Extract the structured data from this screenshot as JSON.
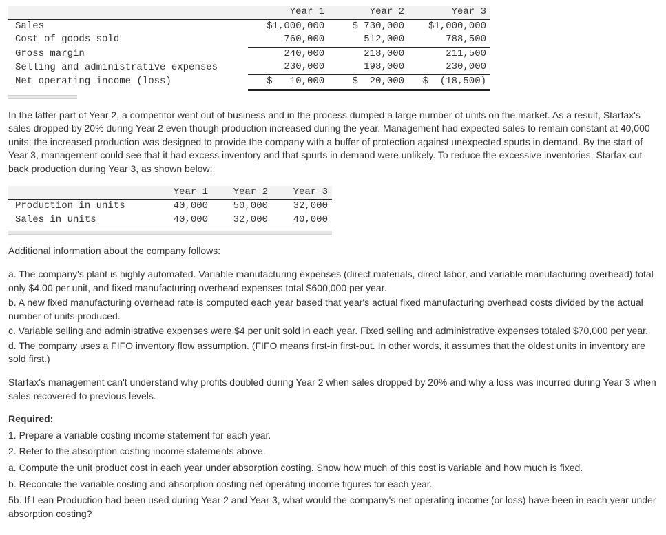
{
  "table1": {
    "headers": [
      "Year 1",
      "Year 2",
      "Year 3"
    ],
    "rows": [
      {
        "label": "Sales",
        "y1": "$1,000,000",
        "y2": "$ 730,000",
        "y3": "$1,000,000"
      },
      {
        "label": "Cost of goods sold",
        "y1": "760,000",
        "y2": "512,000",
        "y3": "788,500"
      },
      {
        "label": "Gross margin",
        "y1": "240,000",
        "y2": "218,000",
        "y3": "211,500"
      },
      {
        "label": "Selling and administrative expenses",
        "y1": "230,000",
        "y2": "198,000",
        "y3": "230,000"
      },
      {
        "label": "Net operating income (loss)",
        "y1": "$   10,000",
        "y2": "$  20,000",
        "y3": "$  (18,500)"
      }
    ]
  },
  "para1": "In the latter part of Year 2, a competitor went out of business and in the process dumped a large number of units on the market. As a result, Starfax's sales dropped by 20% during Year 2 even though production increased during the year. Management had expected sales to remain constant at 40,000 units; the increased production was designed to provide the company with a buffer of protection against unexpected spurts in demand. By the start of Year 3, management could see that it had excess inventory and that spurts in demand were unlikely. To reduce the excessive inventories, Starfax cut back production during Year 3, as shown below:",
  "table2": {
    "headers": [
      "Year 1",
      "Year 2",
      "Year 3"
    ],
    "rows": [
      {
        "label": "Production in units",
        "y1": "40,000",
        "y2": "50,000",
        "y3": "32,000"
      },
      {
        "label": "Sales in units",
        "y1": "40,000",
        "y2": "32,000",
        "y3": "40,000"
      }
    ]
  },
  "additional_intro": "Additional information about the company follows:",
  "items": {
    "a": "a. The company's plant is highly automated. Variable manufacturing expenses (direct materials, direct labor, and variable manufacturing overhead) total only $4.00 per unit, and fixed manufacturing overhead expenses total $600,000 per year.",
    "b": "b. A new fixed manufacturing overhead rate is computed each year based that year's actual fixed manufacturing overhead costs divided by the actual number of units produced.",
    "c": "c. Variable selling and administrative expenses were $4 per unit sold in each year. Fixed selling and administrative expenses totaled $70,000 per year.",
    "d": "d. The company uses a FIFO inventory flow assumption. (FIFO means first-in first-out. In other words, it assumes that the oldest units in inventory are sold first.)"
  },
  "para2": "Starfax's management can't understand why profits doubled during Year 2 when sales dropped by 20% and why a loss was incurred during Year 3 when sales recovered to previous levels.",
  "required_label": "Required:",
  "required": {
    "r1": "1. Prepare a variable costing income statement for each year.",
    "r2": "2. Refer to the absorption costing income statements above.",
    "ra": "a. Compute the unit product cost in each year under absorption costing. Show how much of this cost is variable and how much is fixed.",
    "rb": "b. Reconcile the variable costing and absorption costing net operating income figures for each year.",
    "r5b": "5b. If Lean Production had been used during Year 2 and Year 3, what would the company's net operating income (or loss) have been in each year under absorption costing?"
  }
}
